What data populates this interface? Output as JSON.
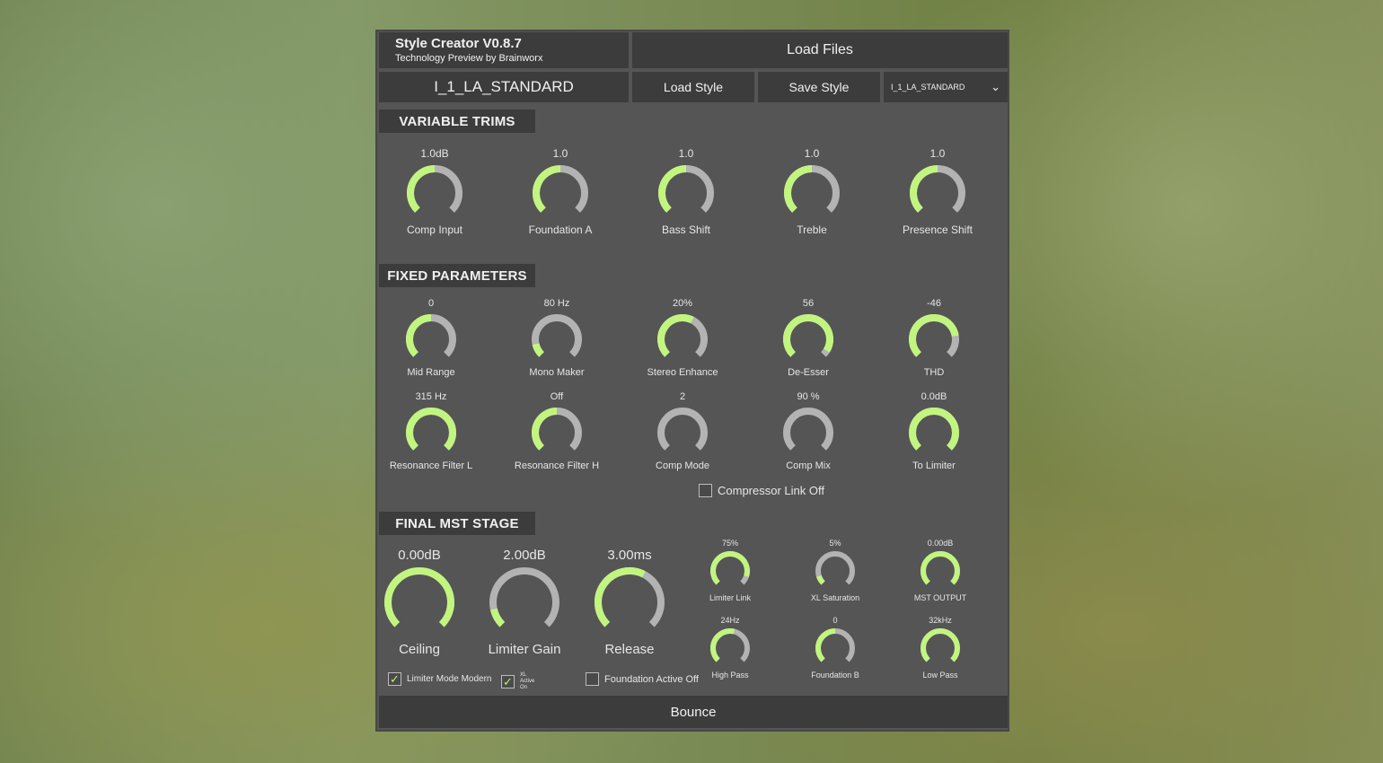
{
  "header": {
    "title": "Style Creator V0.8.7",
    "subtitle": "Technology Preview by Brainworx",
    "load_files": "Load Files",
    "style_name": "I_1_LA_STANDARD",
    "load_style": "Load Style",
    "save_style": "Save Style",
    "style_select": "I_1_LA_STANDARD"
  },
  "sections": {
    "variable_trims": "VARIABLE TRIMS",
    "fixed_parameters": "FIXED PARAMETERS",
    "final_mst_stage": "FINAL MST STAGE"
  },
  "variable_trims": [
    {
      "label": "Comp Input",
      "value": "1.0dB",
      "level": 0.5
    },
    {
      "label": "Foundation A",
      "value": "1.0",
      "level": 0.5
    },
    {
      "label": "Bass Shift",
      "value": "1.0",
      "level": 0.5
    },
    {
      "label": "Treble",
      "value": "1.0",
      "level": 0.5
    },
    {
      "label": "Presence Shift",
      "value": "1.0",
      "level": 0.5
    }
  ],
  "fixed_row1": [
    {
      "label": "Mid Range",
      "value": "0",
      "level": 0.5
    },
    {
      "label": "Mono Maker",
      "value": "80 Hz",
      "level": 0.12
    },
    {
      "label": "Stereo Enhance",
      "value": "20%",
      "level": 0.6
    },
    {
      "label": "De-Esser",
      "value": "56",
      "level": 0.95
    },
    {
      "label": "THD",
      "value": "-46",
      "level": 0.8
    }
  ],
  "fixed_row2": [
    {
      "label": "Resonance Filter L",
      "value": "315 Hz",
      "level": 1.0
    },
    {
      "label": "Resonance Filter H",
      "value": "Off",
      "level": 0.5
    },
    {
      "label": "Comp Mode",
      "value": "2",
      "level": 0.0
    },
    {
      "label": "Comp Mix",
      "value": "90 %",
      "level": 0.0
    },
    {
      "label": "To Limiter",
      "value": "0.0dB",
      "level": 1.0
    }
  ],
  "compressor_link": "Compressor Link Off",
  "final_big": [
    {
      "label": "Ceiling",
      "value": "0.00dB",
      "level": 1.0
    },
    {
      "label": "Limiter Gain",
      "value": "2.00dB",
      "level": 0.12
    },
    {
      "label": "Release",
      "value": "3.00ms",
      "level": 0.6
    }
  ],
  "final_small_row1": [
    {
      "label": "Limiter Link",
      "value": "75%",
      "level": 0.9
    },
    {
      "label": "XL Saturation",
      "value": "5%",
      "level": 0.1
    },
    {
      "label": "MST OUTPUT",
      "value": "0.00dB",
      "level": 1.0
    }
  ],
  "final_small_row2": [
    {
      "label": "High Pass",
      "value": "24Hz",
      "level": 0.55
    },
    {
      "label": "Foundation B",
      "value": "0",
      "level": 0.5
    },
    {
      "label": "Low Pass",
      "value": "32kHz",
      "level": 1.0
    }
  ],
  "checkboxes": {
    "limiter_mode": "Limiter Mode Modern",
    "xl_active": "XL Active On",
    "foundation_active": "Foundation Active Off"
  },
  "bounce": "Bounce",
  "colors": {
    "accent": "#c2f57f",
    "track": "#b3b3b3",
    "panel": "#555555",
    "bar": "#3c3c3c"
  }
}
